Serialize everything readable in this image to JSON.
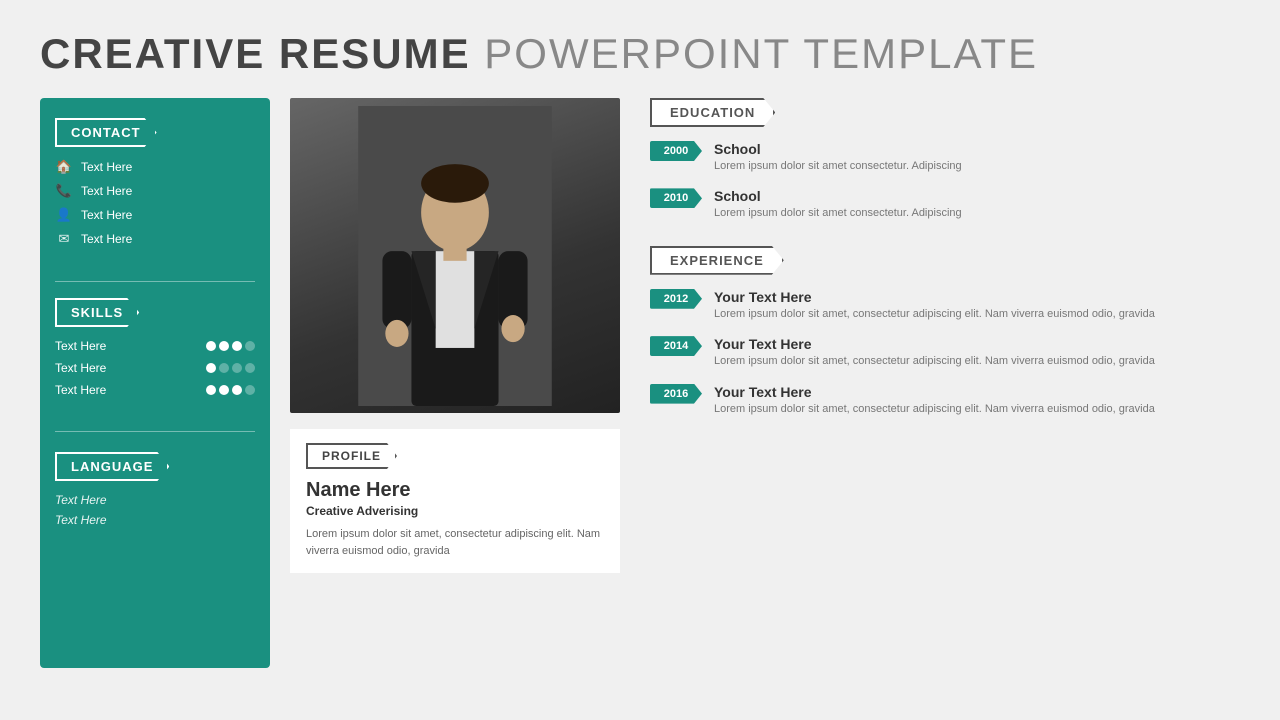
{
  "header": {
    "title_bold": "CREATIVE RESUME",
    "title_light": " POWERPOINT TEMPLATE"
  },
  "sidebar": {
    "contact": {
      "label": "CONTACT",
      "items": [
        {
          "icon": "🏠",
          "text": "Text Here"
        },
        {
          "icon": "📞",
          "text": "Text Here"
        },
        {
          "icon": "👤",
          "text": "Text Here"
        },
        {
          "icon": "✉",
          "text": "Text Here"
        }
      ]
    },
    "skills": {
      "label": "SKILLS",
      "items": [
        {
          "label": "Text Here",
          "filled": 3,
          "total": 4
        },
        {
          "label": "Text Here",
          "filled": 1,
          "total": 4
        },
        {
          "label": "Text Here",
          "filled": 3,
          "total": 4
        }
      ]
    },
    "language": {
      "label": "LANGUAGE",
      "items": [
        {
          "text": "Text Here"
        },
        {
          "text": "Text Here"
        }
      ]
    }
  },
  "profile": {
    "section_label": "PROFILE",
    "name": "Name Here",
    "job_title": "Creative Adverising",
    "bio": "Lorem ipsum dolor sit amet, consectetur adipiscing elit. Nam viverra euismod odio, gravida"
  },
  "education": {
    "label": "EDUCATION",
    "items": [
      {
        "year": "2000",
        "title": "School",
        "text": "Lorem ipsum dolor sit amet consectetur. Adipiscing"
      },
      {
        "year": "2010",
        "title": "School",
        "text": "Lorem ipsum dolor sit amet consectetur. Adipiscing"
      }
    ]
  },
  "experience": {
    "label": "EXPERIENCE",
    "items": [
      {
        "year": "2012",
        "title": "Your Text Here",
        "text": "Lorem ipsum dolor sit amet, consectetur adipiscing elit. Nam viverra euismod odio, gravida"
      },
      {
        "year": "2014",
        "title": "Your Text Here",
        "text": "Lorem ipsum dolor sit amet, consectetur adipiscing elit. Nam viverra euismod odio, gravida"
      },
      {
        "year": "2016",
        "title": "Your Text Here",
        "text": "Lorem ipsum dolor sit amet, consectetur adipiscing elit. Nam viverra euismod odio, gravida"
      }
    ]
  },
  "colors": {
    "teal": "#1a9080",
    "dark": "#444444",
    "gray": "#888888"
  }
}
